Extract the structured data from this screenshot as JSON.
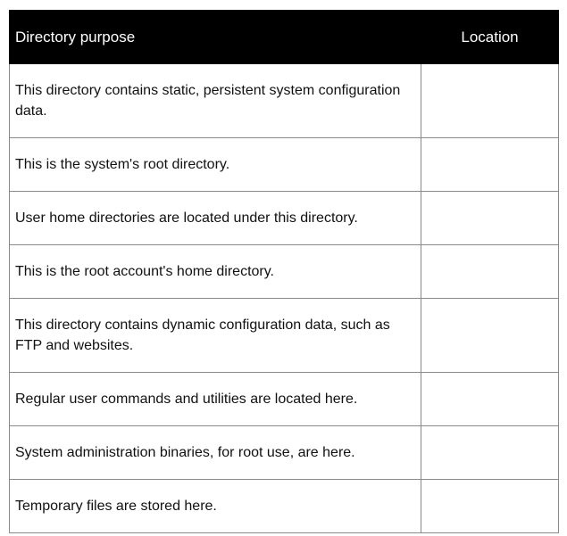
{
  "table": {
    "headers": {
      "purpose": "Directory purpose",
      "location": "Location"
    },
    "rows": [
      {
        "purpose": "This directory contains static, persistent system configuration data.",
        "location": ""
      },
      {
        "purpose": "This is the system's root directory.",
        "location": ""
      },
      {
        "purpose": "User home directories are located under this directory.",
        "location": ""
      },
      {
        "purpose": "This is the root account's home directory.",
        "location": ""
      },
      {
        "purpose": "This directory contains dynamic configuration data, such as FTP and websites.",
        "location": ""
      },
      {
        "purpose": "Regular user commands and utilities are located here.",
        "location": ""
      },
      {
        "purpose": "System administration binaries, for root use, are here.",
        "location": ""
      },
      {
        "purpose": "Temporary files are stored here.",
        "location": ""
      }
    ]
  }
}
